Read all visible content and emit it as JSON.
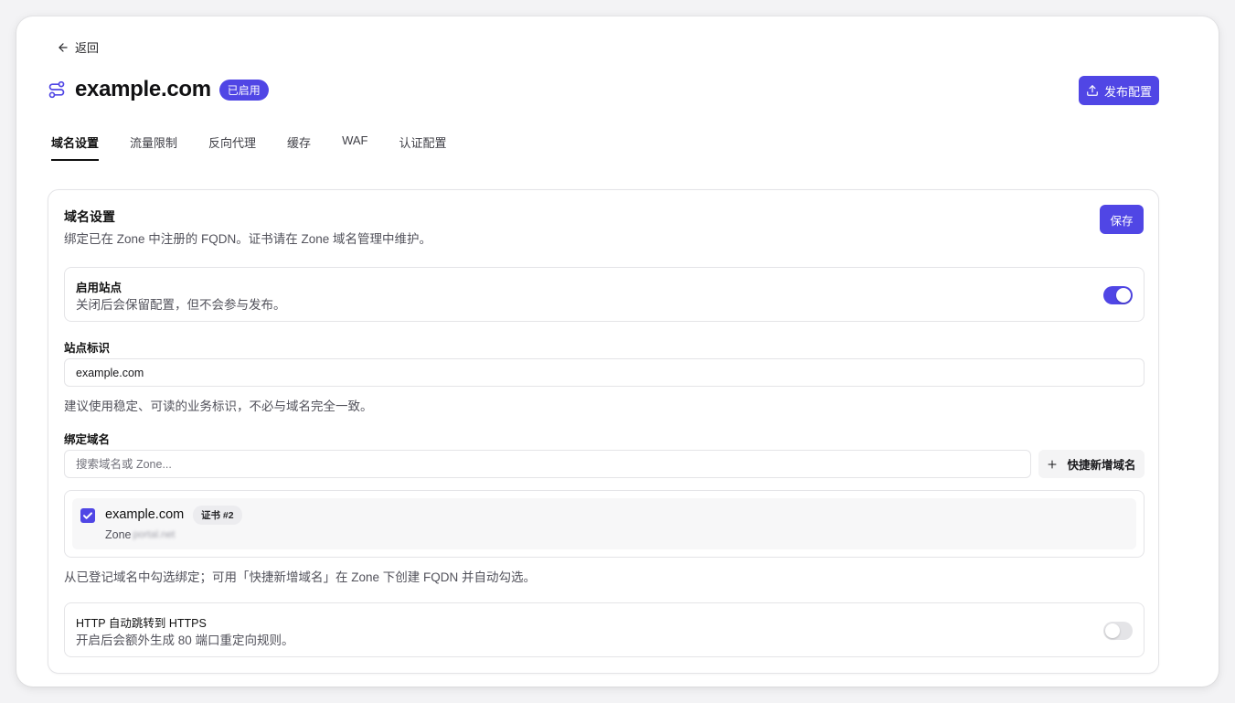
{
  "nav": {
    "back_label": "返回"
  },
  "header": {
    "title": "example.com",
    "status_badge": "已启用",
    "publish_label": "发布配置"
  },
  "tabs": [
    {
      "label": "域名设置",
      "active": true
    },
    {
      "label": "流量限制",
      "active": false
    },
    {
      "label": "反向代理",
      "active": false
    },
    {
      "label": "缓存",
      "active": false
    },
    {
      "label": "WAF",
      "active": false
    },
    {
      "label": "认证配置",
      "active": false
    }
  ],
  "card": {
    "title": "域名设置",
    "description": "绑定已在 Zone 中注册的 FQDN。证书请在 Zone 域名管理中维护。",
    "save_label": "保存"
  },
  "enable_site": {
    "label": "启用站点",
    "description": "关闭后会保留配置，但不会参与发布。",
    "on": true
  },
  "site_id": {
    "label": "站点标识",
    "value": "example.com",
    "helper": "建议使用稳定、可读的业务标识，不必与域名完全一致。"
  },
  "bind_domains": {
    "label": "绑定域名",
    "search_placeholder": "搜索域名或 Zone...",
    "quick_add_label": "快捷新增域名",
    "items": [
      {
        "name": "example.com",
        "cert_badge": "证书 #2",
        "zone_prefix": "Zone",
        "zone_value": "portal.net",
        "checked": true
      }
    ],
    "helper": "从已登记域名中勾选绑定；可用「快捷新增域名」在 Zone 下创建 FQDN 并自动勾选。"
  },
  "https_redirect": {
    "label": "HTTP 自动跳转到 HTTPS",
    "description": "开启后会额外生成 80 端口重定向规则。",
    "on": false
  },
  "colors": {
    "accent": "#5046e5",
    "text": "#18181b",
    "muted": "#52525b",
    "border": "#e4e4e7"
  }
}
